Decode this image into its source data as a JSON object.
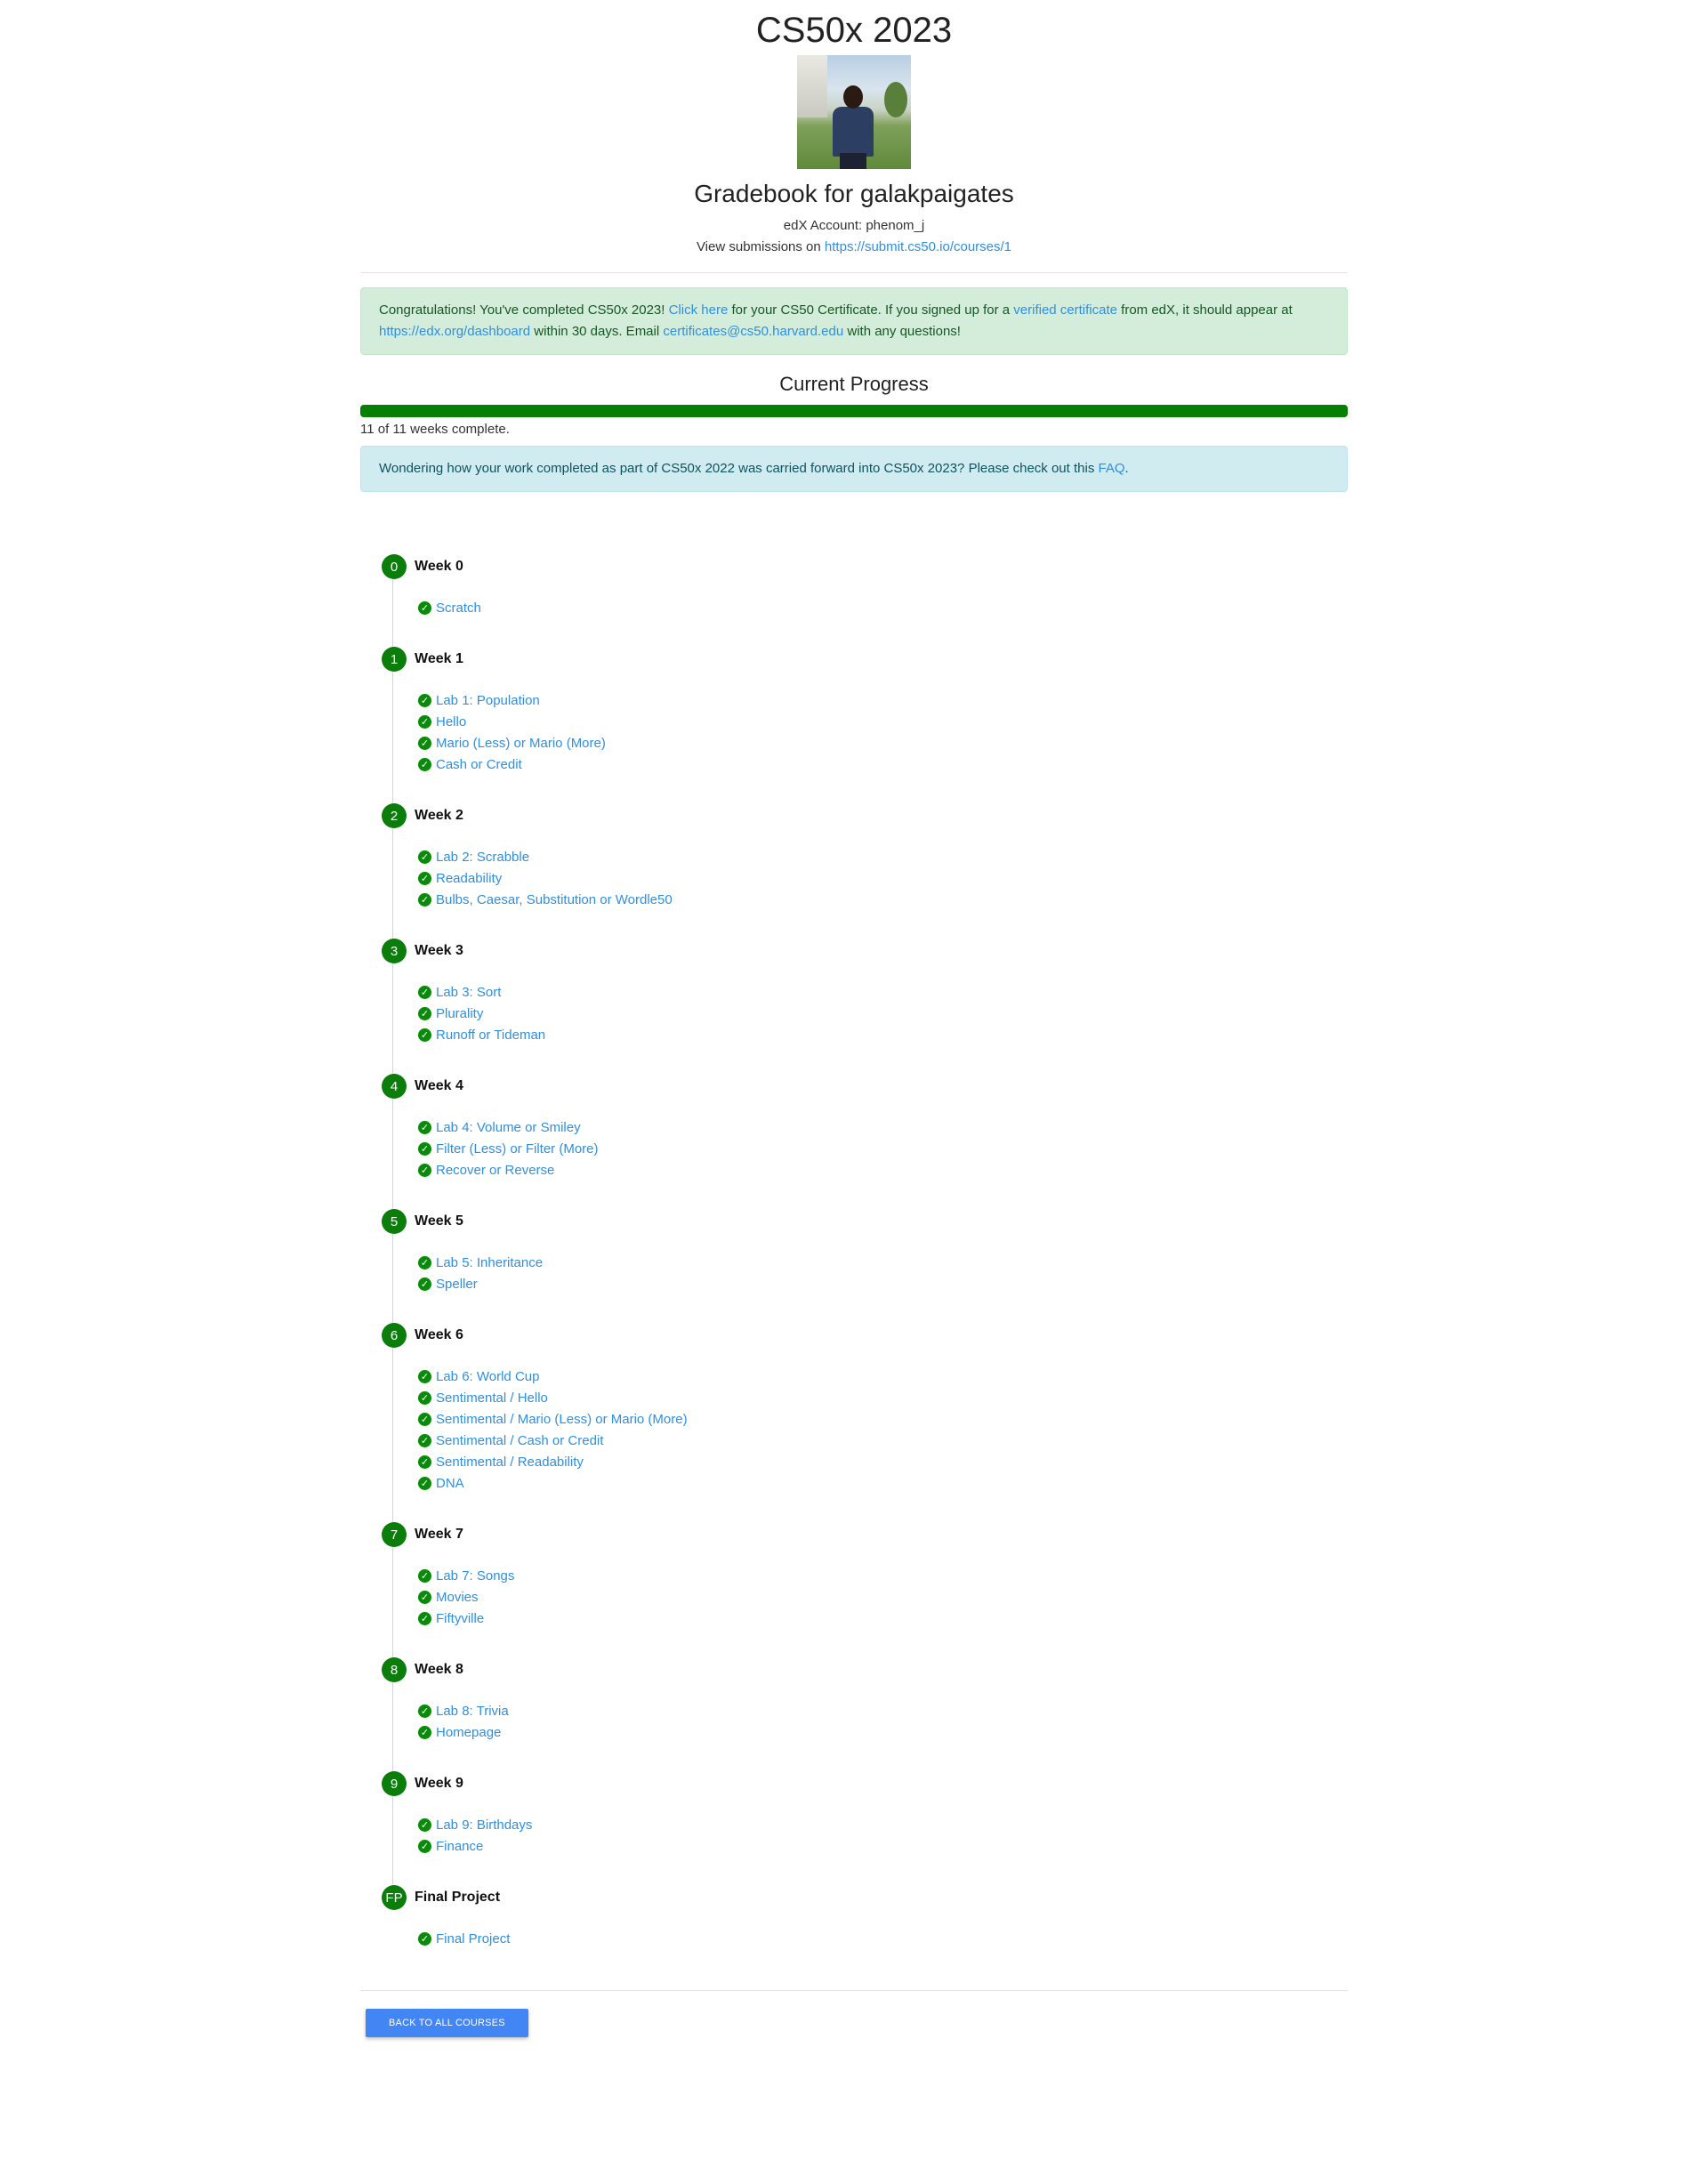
{
  "header": {
    "course_title": "CS50x 2023",
    "gradebook_title": "Gradebook for galakpaigates",
    "account_line": "edX Account: phenom_j",
    "submissions_prefix": "View submissions on",
    "submissions_link": "https://submit.cs50.io/courses/1"
  },
  "congrats": {
    "t1": "Congratulations! You've completed CS50x 2023!",
    "link1": "Click here",
    "t2": "for your CS50 Certificate. If you signed up for a",
    "link2": "verified certificate",
    "t3": "from edX, it should appear at",
    "link3": "https://edx.org/dashboard",
    "t4": "within 30 days. Email",
    "link4": "certificates@cs50.harvard.edu",
    "t5": "with any questions!"
  },
  "progress": {
    "title": "Current Progress",
    "fraction_complete": 1.0,
    "text": "11 of 11 weeks complete."
  },
  "faq": {
    "text": "Wondering how your work completed as part of CS50x 2022 was carried forward into CS50x 2023? Please check out this",
    "link": "FAQ",
    "after": "."
  },
  "weeks": [
    {
      "num": "0",
      "label": "Week 0",
      "items": [
        "Scratch"
      ]
    },
    {
      "num": "1",
      "label": "Week 1",
      "items": [
        "Lab 1: Population",
        "Hello",
        "Mario (Less) or Mario (More)",
        "Cash or Credit"
      ]
    },
    {
      "num": "2",
      "label": "Week 2",
      "items": [
        "Lab 2: Scrabble",
        "Readability",
        "Bulbs, Caesar, Substitution or Wordle50"
      ]
    },
    {
      "num": "3",
      "label": "Week 3",
      "items": [
        "Lab 3: Sort",
        "Plurality",
        "Runoff or Tideman"
      ]
    },
    {
      "num": "4",
      "label": "Week 4",
      "items": [
        "Lab 4: Volume or Smiley",
        "Filter (Less) or Filter (More)",
        "Recover or Reverse"
      ]
    },
    {
      "num": "5",
      "label": "Week 5",
      "items": [
        "Lab 5: Inheritance",
        "Speller"
      ]
    },
    {
      "num": "6",
      "label": "Week 6",
      "items": [
        "Lab 6: World Cup",
        "Sentimental / Hello",
        "Sentimental / Mario (Less) or Mario (More)",
        "Sentimental / Cash or Credit",
        "Sentimental / Readability",
        "DNA"
      ]
    },
    {
      "num": "7",
      "label": "Week 7",
      "items": [
        "Lab 7: Songs",
        "Movies",
        "Fiftyville"
      ]
    },
    {
      "num": "8",
      "label": "Week 8",
      "items": [
        "Lab 8: Trivia",
        "Homepage"
      ]
    },
    {
      "num": "9",
      "label": "Week 9",
      "items": [
        "Lab 9: Birthdays",
        "Finance"
      ]
    },
    {
      "num": "FP",
      "label": "Final Project",
      "items": [
        "Final Project"
      ]
    }
  ],
  "footer": {
    "back_button": "BACK TO ALL COURSES"
  },
  "icons": {
    "check": "check-circle-icon"
  },
  "colors": {
    "link": "#2f8fe0",
    "success_green": "#0a7d0a",
    "button_blue": "#4285f4"
  }
}
